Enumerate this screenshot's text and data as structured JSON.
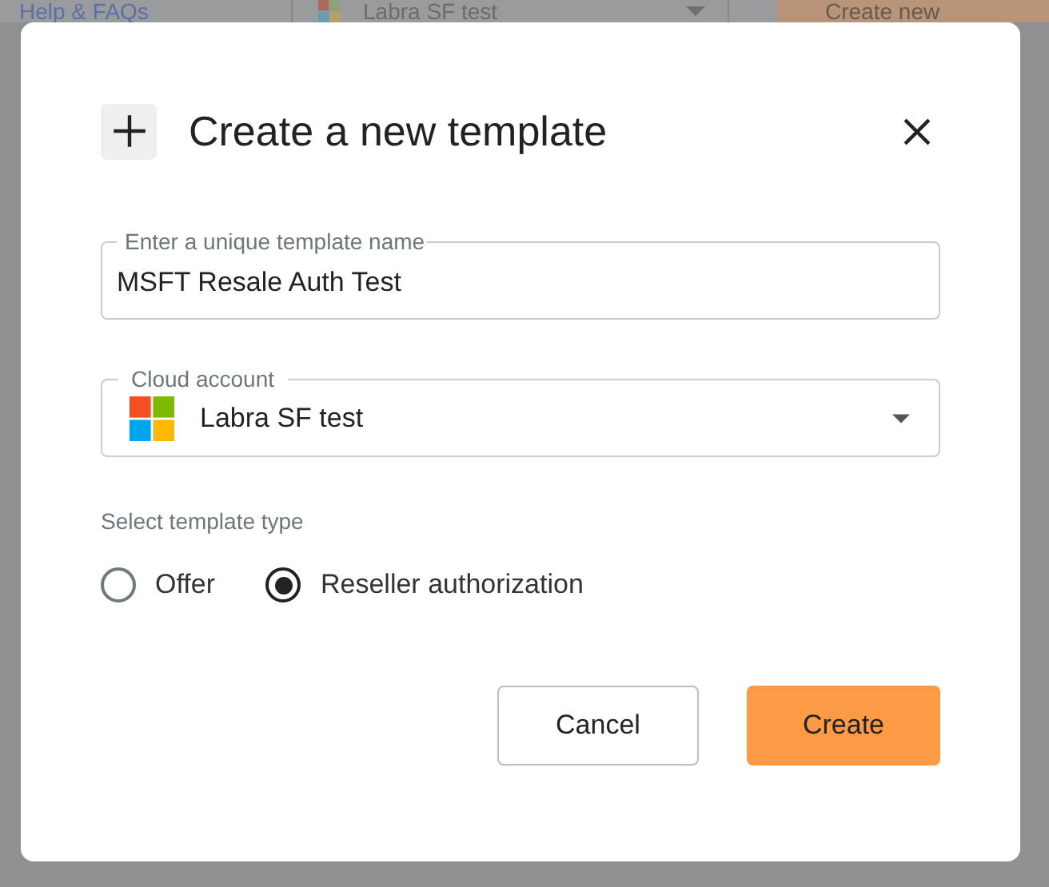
{
  "background": {
    "help_link": "Help & FAQs",
    "account_select": "Labra SF test",
    "create_button": "Create new"
  },
  "dialog": {
    "title": "Create a new template",
    "name_field": {
      "label": "Enter a unique template name",
      "value": "MSFT Resale Auth Test"
    },
    "account_field": {
      "label": "Cloud account",
      "value": "Labra SF test"
    },
    "type_label": "Select template type",
    "types": [
      {
        "label": "Offer",
        "selected": false
      },
      {
        "label": "Reseller authorization",
        "selected": true
      }
    ],
    "buttons": [
      {
        "label": "Cancel",
        "kind": "secondary"
      },
      {
        "label": "Create",
        "kind": "primary"
      }
    ]
  }
}
